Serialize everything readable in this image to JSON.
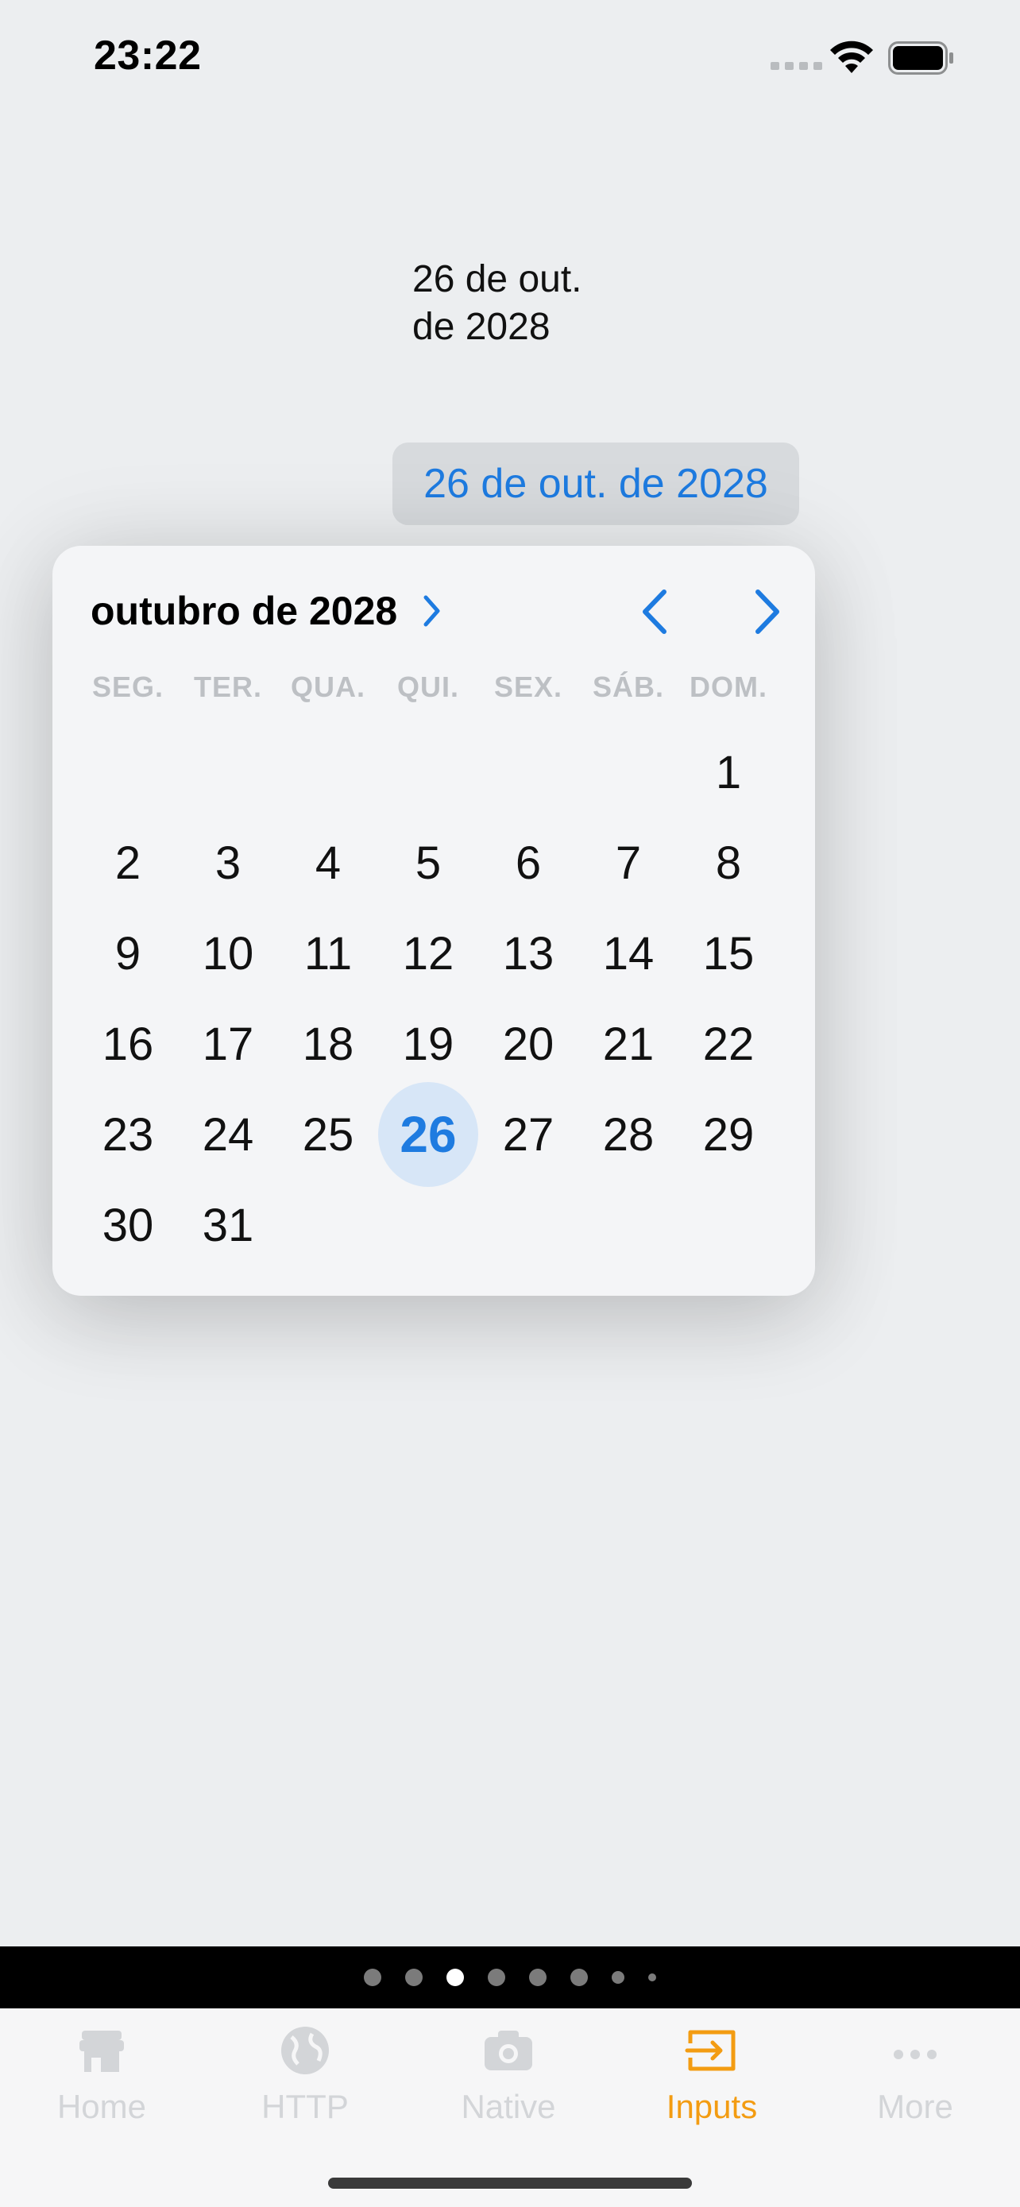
{
  "status_bar": {
    "time": "23:22"
  },
  "date_label": {
    "line1": "26 de out.",
    "line2": "de 2028"
  },
  "date_button": {
    "label": "26 de out. de 2028"
  },
  "calendar": {
    "month_title": "outubro de 2028",
    "weekdays": [
      "SEG.",
      "TER.",
      "QUA.",
      "QUI.",
      "SEX.",
      "SÁB.",
      "DOM."
    ],
    "leading_blanks": 6,
    "days": [
      "1",
      "2",
      "3",
      "4",
      "5",
      "6",
      "7",
      "8",
      "9",
      "10",
      "11",
      "12",
      "13",
      "14",
      "15",
      "16",
      "17",
      "18",
      "19",
      "20",
      "21",
      "22",
      "23",
      "24",
      "25",
      "26",
      "27",
      "28",
      "29",
      "30",
      "31"
    ],
    "selected_day": "26",
    "accent_color": "#1E7BE0",
    "selected_bg_color": "#D7E6F7"
  },
  "page_indicator": {
    "count": 8,
    "active_index": 2
  },
  "tab_bar": {
    "tabs": [
      {
        "label": "Home",
        "icon": "store-icon"
      },
      {
        "label": "HTTP",
        "icon": "globe-icon"
      },
      {
        "label": "Native",
        "icon": "camera-icon"
      },
      {
        "label": "Inputs",
        "icon": "input-icon"
      },
      {
        "label": "More",
        "icon": "more-icon"
      }
    ],
    "active_index": 3,
    "active_color": "#F39C12",
    "inactive_color": "#D3D5D8"
  }
}
